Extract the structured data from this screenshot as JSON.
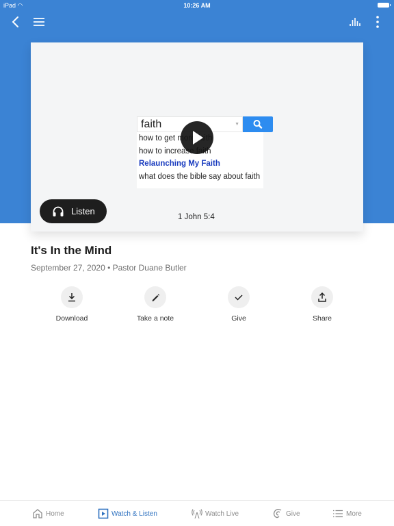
{
  "status_bar": {
    "device": "iPad",
    "time": "10:26 AM"
  },
  "colors": {
    "header_blue": "#3b83d4",
    "active_tab": "#2f72c0",
    "search_button": "#2d8cf0",
    "highlight_suggestion": "#1a3cbf"
  },
  "header": {
    "back_icon": "chevron-left-icon",
    "menu_icon": "hamburger-icon",
    "audio_icon": "equalizer-icon",
    "more_icon": "more-vertical-icon"
  },
  "video": {
    "search_query": "faith",
    "suggestions": [
      {
        "text": "how to get more faith",
        "bold": false
      },
      {
        "text": "how to increase faith",
        "bold": false
      },
      {
        "text": "Relaunching My Faith",
        "bold": true
      },
      {
        "text": "what does the bible say about faith",
        "bold": false
      }
    ],
    "verse": "1 John 5:4",
    "listen_label": "Listen"
  },
  "sermon": {
    "title": "It's In the Mind",
    "meta": "September 27, 2020 • Pastor Duane Butler"
  },
  "actions": [
    {
      "label": "Download",
      "icon": "download-icon"
    },
    {
      "label": "Take a note",
      "icon": "pencil-icon"
    },
    {
      "label": "Give",
      "icon": "checkmark-icon"
    },
    {
      "label": "Share",
      "icon": "share-icon"
    }
  ],
  "tabs": [
    {
      "label": "Home",
      "icon": "home-icon",
      "active": false
    },
    {
      "label": "Watch & Listen",
      "icon": "play-square-icon",
      "active": true
    },
    {
      "label": "Watch Live",
      "icon": "broadcast-icon",
      "active": false
    },
    {
      "label": "Give",
      "icon": "give-icon",
      "active": false
    },
    {
      "label": "More",
      "icon": "list-icon",
      "active": false
    }
  ]
}
